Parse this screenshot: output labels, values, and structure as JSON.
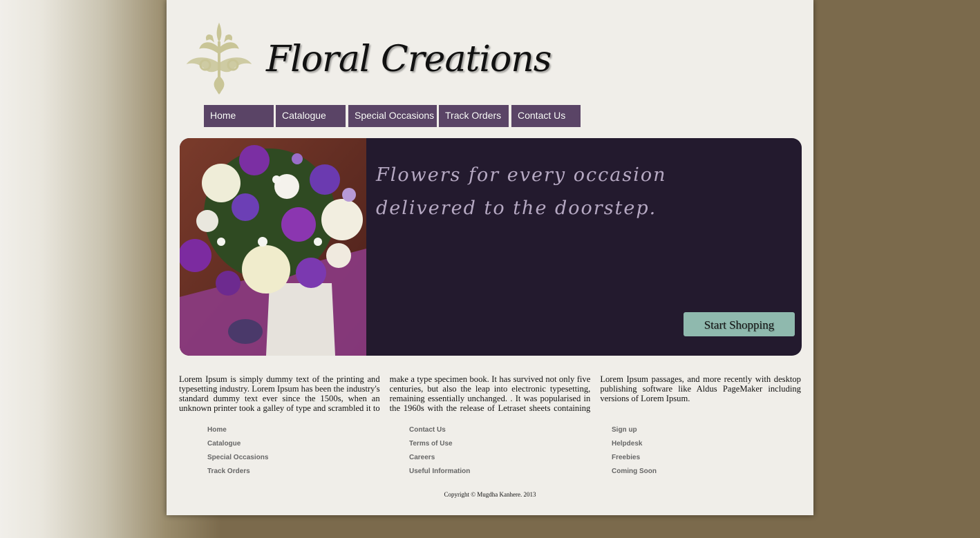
{
  "brand": {
    "name": "Floral Creations",
    "ornament_color": "#c9c597"
  },
  "nav": {
    "items": [
      {
        "label": "Home"
      },
      {
        "label": "Catalogue"
      },
      {
        "label": "Special Occasions"
      },
      {
        "label": "Track Orders"
      },
      {
        "label": "Contact Us"
      }
    ],
    "background": "#5a4466"
  },
  "banner": {
    "tagline_line1": "Flowers for every occasion",
    "tagline_line2": "delivered to the doorstep.",
    "cta_label": "Start Shopping",
    "background": "#231a2e",
    "cta_color": "#8fb9ae"
  },
  "body_text": "Lorem Ipsum is simply dummy text of the printing and typesetting industry. Lorem Ipsum has been the industry's standard dummy text ever since the 1500s, when an unknown printer took a galley of type and scrambled it to make a type specimen book. It has survived not only five centuries, but also the leap into electronic typesetting, remaining essentially unchanged. . It was popularised in the 1960s with the release of Letraset sheets containing Lorem Ipsum passages, and more recently with desktop publishing software like Aldus PageMaker including versions of Lorem Ipsum.",
  "footer": {
    "col1": [
      "Home",
      "Catalogue",
      "Special Occasions",
      "Track Orders"
    ],
    "col2": [
      "Contact Us",
      "Terms of Use",
      "Careers",
      "Useful Information"
    ],
    "col3": [
      "Sign up",
      "Helpdesk",
      "Freebies",
      "Coming Soon"
    ],
    "copyright": "Copyright © Mugdha Kanhere. 2013"
  }
}
